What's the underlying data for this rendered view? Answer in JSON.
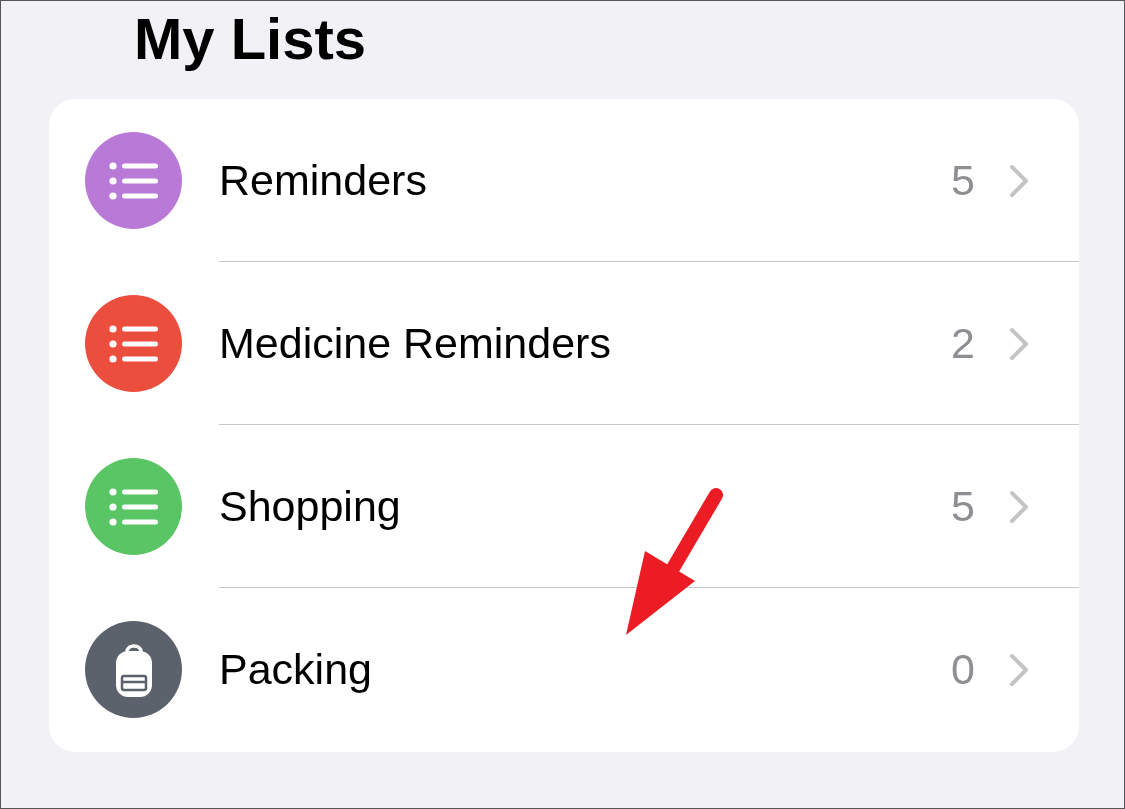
{
  "title": "My Lists",
  "lists": [
    {
      "name": "Reminders",
      "count": "5",
      "color": "#b87ad6",
      "kind": "list"
    },
    {
      "name": "Medicine Reminders",
      "count": "2",
      "color": "#eb4e3d",
      "kind": "list"
    },
    {
      "name": "Shopping",
      "count": "5",
      "color": "#5ac564",
      "kind": "list"
    },
    {
      "name": "Packing",
      "count": "0",
      "color": "#5b626b",
      "kind": "backpack"
    }
  ]
}
